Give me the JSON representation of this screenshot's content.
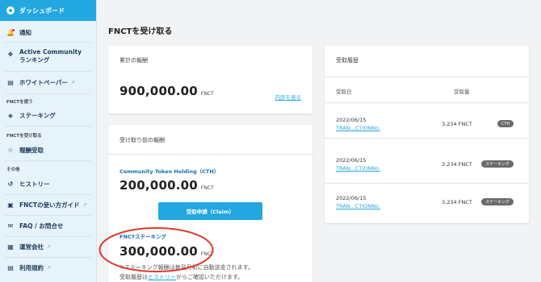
{
  "sidebar": {
    "active": "ダッシュボード",
    "items": [
      {
        "label": "通知",
        "icon": "bell-icon"
      },
      {
        "label": "Active Community ランキング",
        "icon": "trophy-icon"
      },
      {
        "label": "ホワイトペーパー",
        "icon": "book-icon",
        "external": true
      }
    ],
    "group_use": "FNCTを使う",
    "staking": "ステーキング",
    "group_receive": "FNCTを受け取る",
    "reward_receive": "報酬受取",
    "group_other": "その他",
    "other_items": [
      {
        "label": "ヒストリー",
        "icon": "history-icon"
      },
      {
        "label": "FNCTの使い方ガイド",
        "icon": "guide-icon",
        "external": true
      },
      {
        "label": "FAQ / お問合せ",
        "icon": "mail-icon"
      },
      {
        "label": "運営会社",
        "icon": "building-icon",
        "external": true
      },
      {
        "label": "利用規約",
        "icon": "document-icon",
        "external": true
      }
    ]
  },
  "page": {
    "title": "FNCTを受け取る"
  },
  "cumulative": {
    "label": "累計の報酬",
    "amount": "900,000.00",
    "unit": "FNCT",
    "link": "内訳を見る"
  },
  "pending": {
    "label": "受け取り前の報酬",
    "holding_title": "Community Token Holding（CTH）",
    "holding_amount": "200,000.00",
    "unit": "FNCT",
    "claim_button": "受取申請（Claim）",
    "staking_title": "FNCTステーキング",
    "staking_amount": "300,000.00",
    "note_line1": "※ステーキング報酬は毎月月初に自動送金されます。",
    "note_line2_prefix": "受取履歴は",
    "note_line2_link": "ヒストリー",
    "note_line2_suffix": "からご確認いただけます。"
  },
  "history": {
    "title": "受取履歴",
    "col_date": "受取日",
    "col_amount": "受取量",
    "rows": [
      {
        "date": "2022/06/15",
        "tx": "TRAN...CTIONNo.",
        "amount": "3,234 FNCT",
        "badge": "CTH"
      },
      {
        "date": "2022/06/15",
        "tx": "TRAN...CTIONNo.",
        "amount": "3,234 FNCT",
        "badge": "ステーキング"
      },
      {
        "date": "2022/06/15",
        "tx": "TRAN...CTIONNo.",
        "amount": "3,234 FNCT",
        "badge": "ステーキング"
      }
    ]
  },
  "colors": {
    "accent": "#22a7e0",
    "annotation": "#e0382c",
    "badge": "#6b6b6b"
  }
}
